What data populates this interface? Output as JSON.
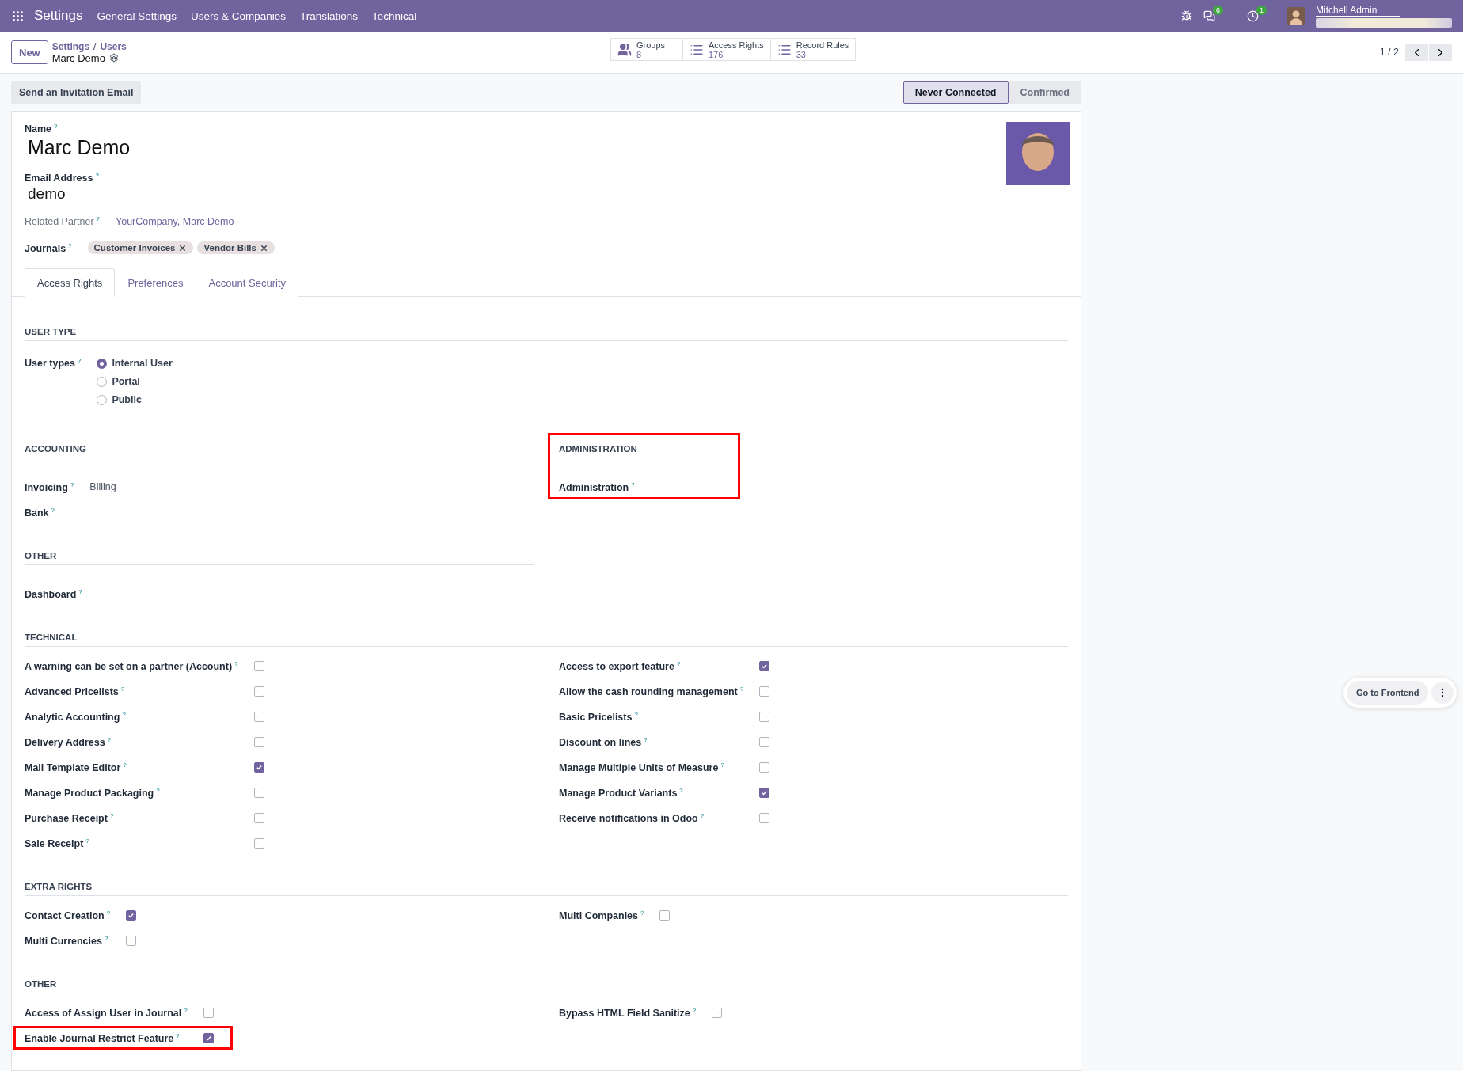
{
  "navbar": {
    "app": "Settings",
    "menu": [
      "General Settings",
      "Users & Companies",
      "Translations",
      "Technical"
    ],
    "chat_count": "6",
    "activity_count": "1",
    "user": "Mitchell Admin"
  },
  "control_panel": {
    "new": "New",
    "path": [
      "Settings",
      "Users"
    ],
    "separator": "/",
    "record": "Marc Demo",
    "pager": "1 / 2"
  },
  "smart_buttons": [
    {
      "kind": "groups",
      "label": "Groups",
      "count": "8"
    },
    {
      "kind": "list",
      "label": "Access Rights",
      "count": "176"
    },
    {
      "kind": "list",
      "label": "Record Rules",
      "count": "33"
    }
  ],
  "actions": [
    "Send an Invitation Email"
  ],
  "status": [
    {
      "label": "Never Connected",
      "selected": true
    },
    {
      "label": "Confirmed",
      "selected": false
    }
  ],
  "header_fields": [
    {
      "kind": "title",
      "label": "Name",
      "help": "?",
      "value": "Marc Demo"
    },
    {
      "kind": "big",
      "label": "Email Address",
      "help": "?",
      "value": "demo"
    },
    {
      "kind": "link",
      "label": "Related Partner",
      "help": "?",
      "value": "YourCompany, Marc Demo"
    },
    {
      "kind": "tags",
      "label": "Journals",
      "help": "?",
      "tags": [
        "Customer Invoices",
        "Vendor Bills"
      ]
    }
  ],
  "tabs": [
    {
      "label": "Access Rights",
      "selected": true
    },
    {
      "label": "Preferences",
      "selected": false
    },
    {
      "label": "Account Security",
      "selected": false
    }
  ],
  "blocks": [
    {
      "kind": "wide",
      "title": "USER TYPE",
      "columns": [
        [
          {
            "kind": "radio",
            "label": "User types",
            "help": "?",
            "options": [
              {
                "label": "Internal User",
                "selected": true
              },
              {
                "label": "Portal",
                "selected": false
              },
              {
                "label": "Public",
                "selected": false
              }
            ]
          }
        ]
      ]
    },
    {
      "kind": "split",
      "groups": [
        {
          "title": "ACCOUNTING",
          "fields": [
            {
              "kind": "select",
              "label": "Invoicing",
              "help": "?",
              "value": "Billing"
            },
            {
              "kind": "empty",
              "label": "Bank",
              "help": "?"
            }
          ]
        },
        {
          "title": "ADMINISTRATION",
          "highlighted": true,
          "fields": [
            {
              "kind": "empty",
              "label": "Administration",
              "help": "?"
            }
          ]
        }
      ]
    },
    {
      "kind": "split",
      "groups": [
        {
          "title": "OTHER",
          "fields": [
            {
              "kind": "empty",
              "label": "Dashboard",
              "help": "?"
            }
          ]
        }
      ]
    },
    {
      "kind": "wide",
      "title": "TECHNICAL",
      "columns": [
        [
          {
            "kind": "checkbox",
            "label": "A warning can be set on a partner (Account)",
            "help": "?",
            "checked": false
          },
          {
            "kind": "checkbox",
            "label": "Advanced Pricelists",
            "help": "?",
            "checked": false
          },
          {
            "kind": "checkbox",
            "label": "Analytic Accounting",
            "help": "?",
            "checked": false
          },
          {
            "kind": "checkbox",
            "label": "Delivery Address",
            "help": "?",
            "checked": false
          },
          {
            "kind": "checkbox",
            "label": "Mail Template Editor",
            "help": "?",
            "checked": true
          },
          {
            "kind": "checkbox",
            "label": "Manage Product Packaging",
            "help": "?",
            "checked": false
          },
          {
            "kind": "checkbox",
            "label": "Purchase Receipt",
            "help": "?",
            "checked": false
          },
          {
            "kind": "checkbox",
            "label": "Sale Receipt",
            "help": "?",
            "checked": false
          }
        ],
        [
          {
            "kind": "checkbox",
            "label": "Access to export feature",
            "help": "?",
            "checked": true
          },
          {
            "kind": "checkbox",
            "label": "Allow the cash rounding management",
            "help": "?",
            "checked": false
          },
          {
            "kind": "checkbox",
            "label": "Basic Pricelists",
            "help": "?",
            "checked": false
          },
          {
            "kind": "checkbox",
            "label": "Discount on lines",
            "help": "?",
            "checked": false
          },
          {
            "kind": "checkbox",
            "label": "Manage Multiple Units of Measure",
            "help": "?",
            "checked": false
          },
          {
            "kind": "checkbox",
            "label": "Manage Product Variants",
            "help": "?",
            "checked": true
          },
          {
            "kind": "checkbox",
            "label": "Receive notifications in Odoo",
            "help": "?",
            "checked": false
          }
        ]
      ]
    },
    {
      "kind": "wide",
      "title": "EXTRA RIGHTS",
      "columns": [
        [
          {
            "kind": "checkbox",
            "label": "Contact Creation",
            "help": "?",
            "checked": true
          },
          {
            "kind": "checkbox",
            "label": "Multi Currencies",
            "help": "?",
            "checked": false
          }
        ],
        [
          {
            "kind": "checkbox",
            "label": "Multi Companies",
            "help": "?",
            "checked": false
          }
        ]
      ]
    },
    {
      "kind": "wide",
      "title": "OTHER",
      "columns": [
        [
          {
            "kind": "checkbox",
            "label": "Access of Assign User in Journal",
            "help": "?",
            "checked": false
          },
          {
            "kind": "checkbox",
            "label": "Enable Journal Restrict Feature",
            "help": "?",
            "checked": true,
            "highlighted": true
          }
        ],
        [
          {
            "kind": "checkbox",
            "label": "Bypass HTML Field Sanitize",
            "help": "?",
            "checked": false
          }
        ]
      ]
    }
  ],
  "floating": {
    "label": "Go to Frontend"
  }
}
